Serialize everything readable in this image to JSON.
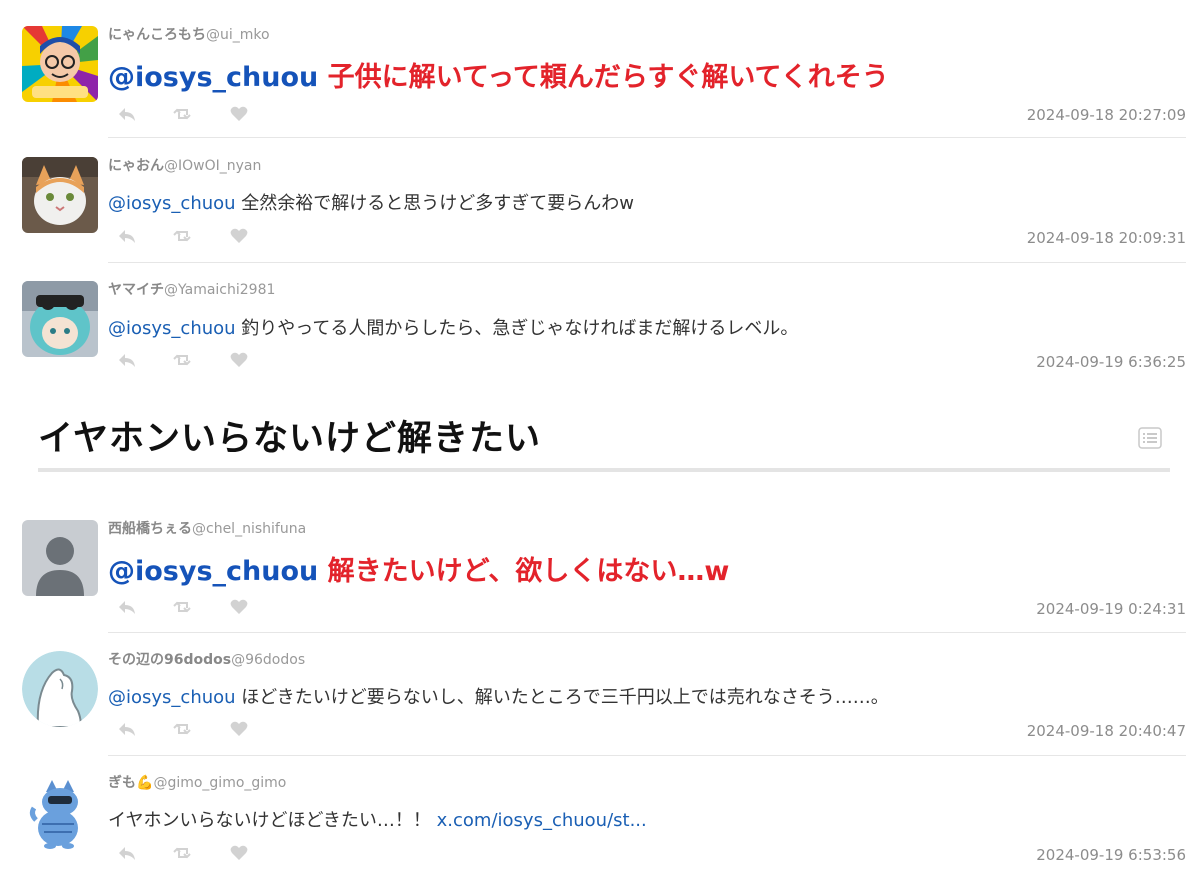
{
  "colors": {
    "mention": "#1553b9",
    "highlight": "#e3232b",
    "timestamp": "#8c8c8c",
    "action_icon": "#cfcfcf"
  },
  "action_icons": [
    "reply-icon",
    "retweet-icon",
    "like-icon"
  ],
  "section": {
    "heading": "イヤホンいらないけど解きたい",
    "toc_icon": "list-icon"
  },
  "tweets": [
    {
      "display": "にゃんころもち",
      "handle": "@ui_mko",
      "mention": "@iosys_chuou",
      "text": " 子供に解いてって頼んだらすぐ解いてくれそう",
      "time": "2024-09-18 20:27:09"
    },
    {
      "display": "にゃおん",
      "handle": "@IOwOI_nyan",
      "mention": "@iosys_chuou",
      "text": " 全然余裕で解けると思うけど多すぎて要らんわw",
      "time": "2024-09-18 20:09:31"
    },
    {
      "display": "ヤマイチ",
      "handle": "@Yamaichi2981",
      "mention": "@iosys_chuou",
      "text": " 釣りやってる人間からしたら、急ぎじゃなければまだ解けるレベル。",
      "time": "2024-09-19 6:36:25"
    },
    {
      "display": "西船橋ちぇる",
      "handle": "@chel_nishifuna",
      "mention": "@iosys_chuou",
      "text": " 解きたいけど、欲しくはない…w",
      "time": "2024-09-19 0:24:31"
    },
    {
      "display": "その辺の96dodos",
      "handle": "@96dodos",
      "mention": "@iosys_chuou",
      "text": " ほどきたいけど要らないし、解いたところで三千円以上では売れなさそう……。",
      "time": "2024-09-18 20:40:47"
    },
    {
      "display": "ぎも💪",
      "handle": "@gimo_gimo_gimo",
      "text": "イヤホンいらないけどほどきたい…！！ ",
      "link": "x.com/iosys_chuou/st...",
      "time": "2024-09-19 6:53:56"
    }
  ]
}
